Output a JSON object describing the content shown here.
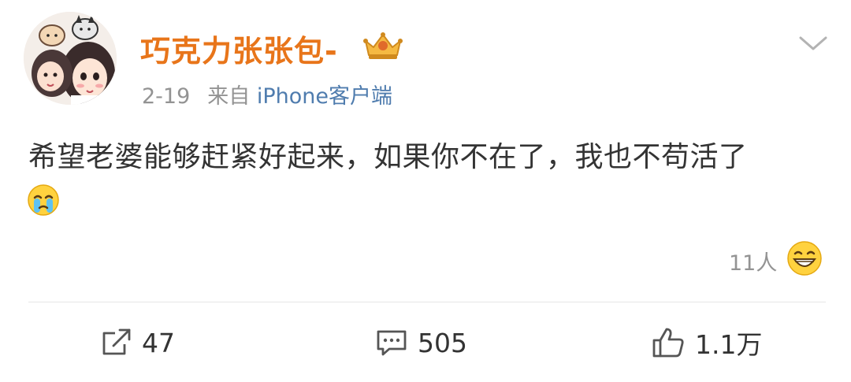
{
  "post": {
    "username": "巧克力张张包-",
    "date": "2-19",
    "source_prefix": "来自",
    "source": "iPhone客户端",
    "text": "希望老婆能够赶紧好起来，如果你不在了，我也不苟活了",
    "reaction_count": "11人"
  },
  "actions": {
    "repost_count": "47",
    "comment_count": "505",
    "like_count": "1.1万"
  },
  "icons": {
    "menu": "chevron-down-icon",
    "badge": "crown-icon",
    "repost": "repost-icon",
    "comment": "comment-icon",
    "like": "thumbs-up-icon",
    "emoji_inline": "crying-face-icon",
    "reaction": "grinning-face-icon"
  },
  "colors": {
    "username": "#e8751a",
    "source_link": "#4f7cae",
    "muted": "#939393",
    "text": "#333333"
  }
}
